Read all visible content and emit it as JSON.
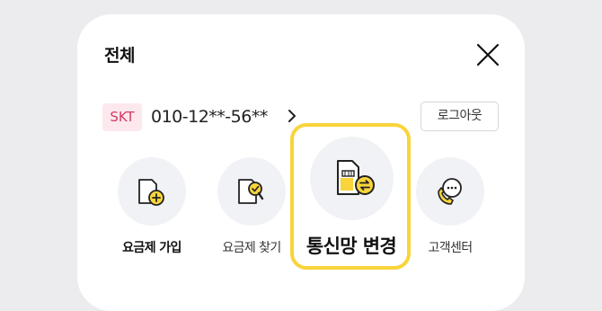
{
  "header": {
    "title": "전체",
    "close_icon": "close-icon"
  },
  "account": {
    "carrier": "SKT",
    "phone": "010-12**-56**",
    "logout_label": "로그아웃"
  },
  "menu": [
    {
      "label": "요금제 가입",
      "icon": "plan-join-icon"
    },
    {
      "label": "요금제 찾기",
      "icon": "plan-search-icon"
    },
    {
      "label": "통신망 변경",
      "icon": "network-change-icon"
    },
    {
      "label": "고객센터",
      "icon": "customer-center-icon"
    }
  ],
  "colors": {
    "accent": "#f9d43b",
    "carrier_bg": "#fde8ee",
    "carrier_text": "#d43b63"
  }
}
